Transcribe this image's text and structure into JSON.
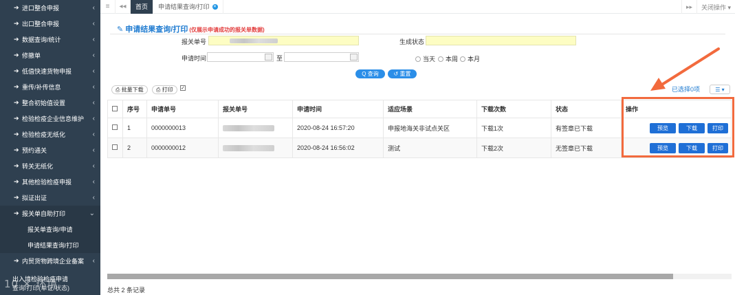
{
  "sidebar": {
    "items": [
      {
        "icon": "sign-in-icon",
        "label": "进口整合申报",
        "chev": "‹"
      },
      {
        "icon": "sign-out-icon",
        "label": "出口整合申报",
        "chev": "‹"
      },
      {
        "icon": "sign-out-icon",
        "label": "数据查询/统计",
        "chev": "‹"
      },
      {
        "icon": "sign-out-icon",
        "label": "修撤单",
        "chev": "‹"
      },
      {
        "icon": "sign-out-icon",
        "label": "低值快速货物申报",
        "chev": "‹"
      },
      {
        "icon": "sign-out-icon",
        "label": "重传/补传信息",
        "chev": "‹"
      },
      {
        "icon": "sign-out-icon",
        "label": "整合初始值设置",
        "chev": "‹"
      },
      {
        "icon": "sign-out-icon",
        "label": "检验检疫企业信息维护",
        "chev": "‹"
      },
      {
        "icon": "sign-out-icon",
        "label": "检验检疫无纸化",
        "chev": "‹"
      },
      {
        "icon": "sign-out-icon",
        "label": "预约通关",
        "chev": "‹"
      },
      {
        "icon": "sign-out-icon",
        "label": "转关无纸化",
        "chev": "‹"
      },
      {
        "icon": "sign-out-icon",
        "label": "其他检验检疫申报",
        "chev": "‹"
      },
      {
        "icon": "sign-out-icon",
        "label": "拟证出证",
        "chev": "‹"
      },
      {
        "icon": "sign-out-icon",
        "label": "报关单自助打印",
        "chev": "⌄"
      }
    ],
    "subitems": [
      "报关单查询/申请",
      "申请结果查询/打印"
    ],
    "after": [
      {
        "icon": "sign-out-icon",
        "label": "内贸货物跨境企业备案",
        "chev": "‹"
      }
    ],
    "bottom_text_1": "出入境检验检疫申请",
    "bottom_text_2": "查询/打印(单证/状态)",
    "watermark": "10 ✕ 环境"
  },
  "topbar": {
    "menu_icon": "≡",
    "back_icon": "◂◂",
    "tabs": [
      {
        "label": "首页",
        "active": true
      },
      {
        "label": "申请结果查询/打印",
        "active": false
      }
    ],
    "forward_icon": "▸▸",
    "close_ops": "关闭操作 ▾"
  },
  "panel": {
    "title": "申请结果查询/打印",
    "subtitle": "(仅展示申请成功的报关单数据)",
    "labels": {
      "declaration_no": "报关单号",
      "gen_status": "生成状态",
      "apply_time": "申请时间",
      "to": "至"
    },
    "radios": [
      "当天",
      "本周",
      "本月"
    ],
    "query_btn": "Q 查询",
    "reset_btn": "↺ 重置"
  },
  "toolbar": {
    "batch_download": "批量下载",
    "print": "打印",
    "selected": "已选择0项",
    "cols_btn": "☰ ▾"
  },
  "table": {
    "headers": [
      "序号",
      "申请单号",
      "报关单号",
      "申请时间",
      "适应场景",
      "下载次数",
      "状态",
      "操作"
    ],
    "rows": [
      {
        "seq": "1",
        "apply_no": "0000000013",
        "apply_time": "2020-08-24 16:57:20",
        "scene": "申报地海关非试点关区",
        "downloads": "下载1次",
        "status": "有签章已下载"
      },
      {
        "seq": "2",
        "apply_no": "0000000012",
        "apply_time": "2020-08-24 16:56:02",
        "scene": "测试",
        "downloads": "下载2次",
        "status": "无签章已下载"
      }
    ],
    "actions": [
      "预览",
      "下载",
      "打印"
    ]
  },
  "footer": {
    "total": "总共 2 条记录"
  },
  "colors": {
    "sidebar": "#2f4050",
    "accent": "#1f7bd0",
    "highlight": "#f26a3d",
    "action_btn": "#1f6fd6"
  }
}
